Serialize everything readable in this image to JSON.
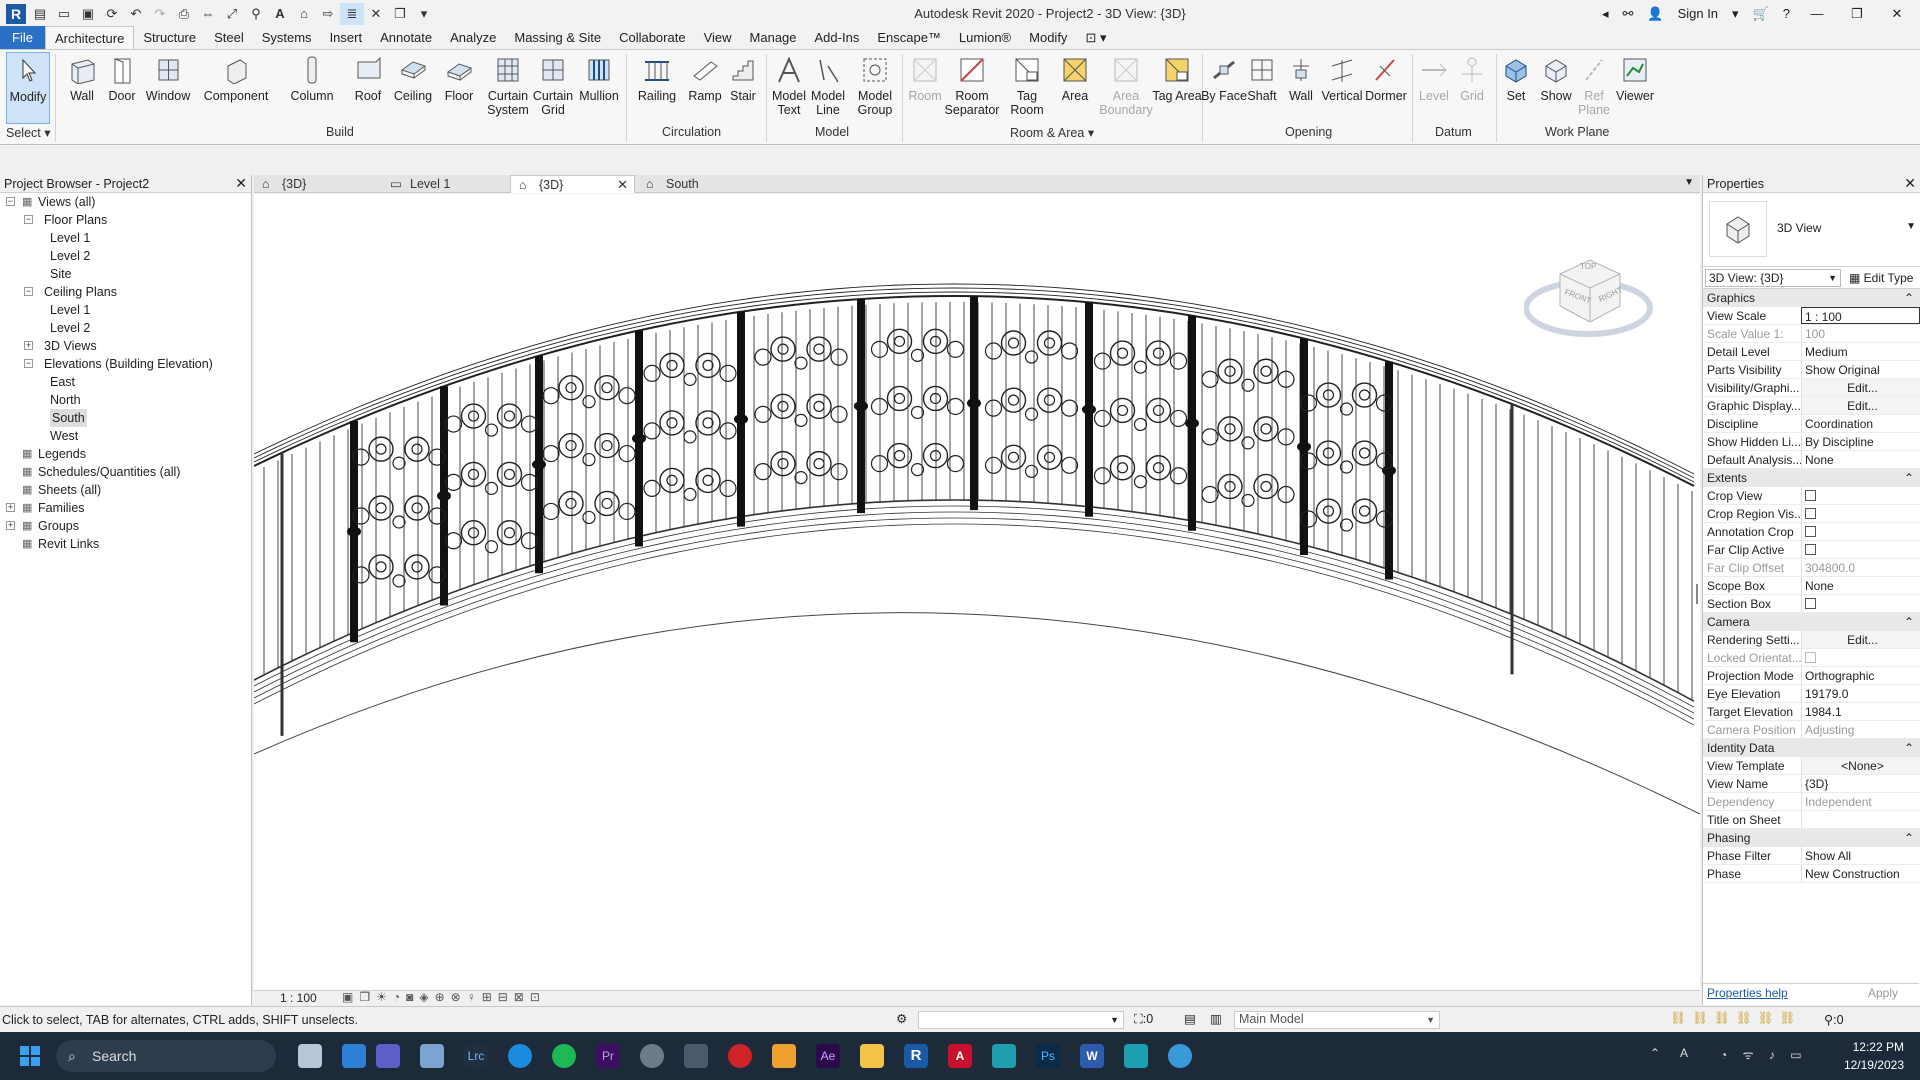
{
  "title_bar": {
    "app_title": "Autodesk Revit 2020 - Project2 - 3D View: {3D}",
    "sign_in": "Sign In",
    "logo": "R"
  },
  "ribbon_tabs": [
    "File",
    "Architecture",
    "Structure",
    "Steel",
    "Systems",
    "Insert",
    "Annotate",
    "Analyze",
    "Massing & Site",
    "Collaborate",
    "View",
    "Manage",
    "Add-Ins",
    "Enscape™",
    "Lumion®",
    "Modify"
  ],
  "ribbon": {
    "select_label": "Select",
    "modify": "Modify",
    "build": {
      "label": "Build",
      "items": [
        "Wall",
        "Door",
        "Window",
        "Component",
        "Column",
        "Roof",
        "Ceiling",
        "Floor",
        "Curtain System",
        "Curtain Grid",
        "Mullion"
      ]
    },
    "circulation": {
      "label": "Circulation",
      "items": [
        "Railing",
        "Ramp",
        "Stair"
      ]
    },
    "model": {
      "label": "Model",
      "items": [
        "Model Text",
        "Model Line",
        "Model Group"
      ]
    },
    "room_area": {
      "label": "Room & Area",
      "items": [
        "Room",
        "Room Separator",
        "Tag Room",
        "Area",
        "Area Boundary",
        "Tag Area"
      ]
    },
    "opening": {
      "label": "Opening",
      "items": [
        "By Face",
        "Shaft",
        "Wall",
        "Vertical",
        "Dormer"
      ]
    },
    "datum": {
      "label": "Datum",
      "items": [
        "Level",
        "Grid"
      ]
    },
    "work_plane": {
      "label": "Work Plane",
      "items": [
        "Set",
        "Show",
        "Ref Plane",
        "Viewer"
      ]
    }
  },
  "project_browser": {
    "title": "Project Browser - Project2",
    "tree": [
      {
        "label": "Views (all)",
        "level": 0,
        "exp": "−"
      },
      {
        "label": "Floor Plans",
        "level": 1,
        "exp": "−"
      },
      {
        "label": "Level 1",
        "level": 2
      },
      {
        "label": "Level 2",
        "level": 2
      },
      {
        "label": "Site",
        "level": 2
      },
      {
        "label": "Ceiling Plans",
        "level": 1,
        "exp": "−"
      },
      {
        "label": "Level 1",
        "level": 2
      },
      {
        "label": "Level 2",
        "level": 2
      },
      {
        "label": "3D Views",
        "level": 1,
        "exp": "+"
      },
      {
        "label": "Elevations (Building Elevation)",
        "level": 1,
        "exp": "−"
      },
      {
        "label": "East",
        "level": 2
      },
      {
        "label": "North",
        "level": 2
      },
      {
        "label": "South",
        "level": 2,
        "selected": true
      },
      {
        "label": "West",
        "level": 2
      },
      {
        "label": "Legends",
        "level": 0
      },
      {
        "label": "Schedules/Quantities (all)",
        "level": 0
      },
      {
        "label": "Sheets (all)",
        "level": 0
      },
      {
        "label": "Families",
        "level": 0,
        "exp": "+"
      },
      {
        "label": "Groups",
        "level": 0,
        "exp": "+"
      },
      {
        "label": "Revit Links",
        "level": 0
      }
    ]
  },
  "view_tabs": [
    {
      "label": "{3D}",
      "active": false
    },
    {
      "label": "Level 1",
      "active": false
    },
    {
      "label": "{3D}",
      "active": true
    },
    {
      "label": "South",
      "active": false
    }
  ],
  "view_cube": {
    "top": "TOP",
    "front": "FRONT",
    "right": "RIGHT"
  },
  "view_control_bar": {
    "scale": "1 : 100"
  },
  "properties": {
    "title": "Properties",
    "type_name": "3D View",
    "type_selector": "3D View: {3D}",
    "edit_type": "Edit Type",
    "groups": [
      {
        "name": "Graphics",
        "rows": [
          {
            "n": "View Scale",
            "v": "1 : 100"
          },
          {
            "n": "Scale Value    1:",
            "v": "100",
            "dim": true
          },
          {
            "n": "Detail Level",
            "v": "Medium"
          },
          {
            "n": "Parts Visibility",
            "v": "Show Original"
          },
          {
            "n": "Visibility/Graphi...",
            "v": "Edit...",
            "btn": true
          },
          {
            "n": "Graphic Display...",
            "v": "Edit...",
            "btn": true
          },
          {
            "n": "Discipline",
            "v": "Coordination"
          },
          {
            "n": "Show Hidden Li...",
            "v": "By Discipline"
          },
          {
            "n": "Default Analysis...",
            "v": "None"
          }
        ]
      },
      {
        "name": "Extents",
        "rows": [
          {
            "n": "Crop View",
            "v": "",
            "check": true
          },
          {
            "n": "Crop Region Vis...",
            "v": "",
            "check": true
          },
          {
            "n": "Annotation Crop",
            "v": "",
            "check": true
          },
          {
            "n": "Far Clip Active",
            "v": "",
            "check": true
          },
          {
            "n": "Far Clip Offset",
            "v": "304800.0",
            "dim": true
          },
          {
            "n": "Scope Box",
            "v": "None"
          },
          {
            "n": "Section Box",
            "v": "",
            "check": true
          }
        ]
      },
      {
        "name": "Camera",
        "rows": [
          {
            "n": "Rendering Setti...",
            "v": "Edit...",
            "btn": true
          },
          {
            "n": "Locked Orientat...",
            "v": "",
            "dim": true,
            "check": true
          },
          {
            "n": "Projection Mode",
            "v": "Orthographic"
          },
          {
            "n": "Eye Elevation",
            "v": "19179.0"
          },
          {
            "n": "Target Elevation",
            "v": "1984.1"
          },
          {
            "n": "Camera Position",
            "v": "Adjusting",
            "dim": true
          }
        ]
      },
      {
        "name": "Identity Data",
        "rows": [
          {
            "n": "View Template",
            "v": "<None>",
            "btn": true
          },
          {
            "n": "View Name",
            "v": "{3D}"
          },
          {
            "n": "Dependency",
            "v": "Independent",
            "dim": true
          },
          {
            "n": "Title on Sheet",
            "v": ""
          }
        ]
      },
      {
        "name": "Phasing",
        "rows": [
          {
            "n": "Phase Filter",
            "v": "Show All"
          },
          {
            "n": "Phase",
            "v": "New Construction"
          }
        ]
      }
    ],
    "help_link": "Properties help",
    "apply": "Apply"
  },
  "status_bar": {
    "message": "Click to select, TAB for alternates, CTRL adds, SHIFT unselects.",
    "sel_count": ":0",
    "model": "Main Model",
    "filter_count": ":0"
  },
  "taskbar": {
    "search": "Search",
    "time": "12:22 PM",
    "date": "12/19/2023"
  }
}
